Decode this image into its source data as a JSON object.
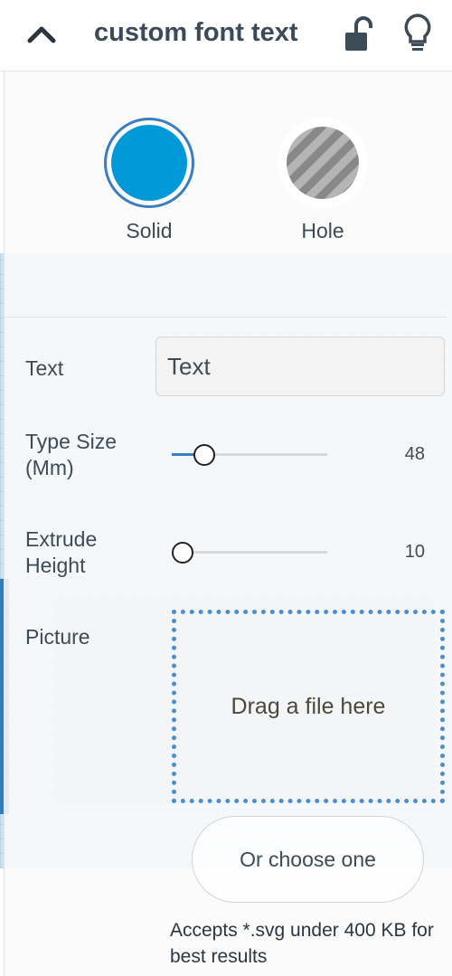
{
  "header": {
    "title": "custom font text"
  },
  "shape_types": [
    {
      "label": "Solid",
      "color": "#0099d8",
      "selected": true
    },
    {
      "label": "Hole",
      "color": "#9e9e9e",
      "selected": false
    }
  ],
  "properties": {
    "text": {
      "label": "Text",
      "value": "Text"
    },
    "type_size": {
      "label": "Type Size (Mm)",
      "value": "48"
    },
    "extrude_height": {
      "label": "Extrude Height",
      "value": "10"
    },
    "picture": {
      "label": "Picture"
    }
  },
  "dropzone": {
    "label": "Drag a file here"
  },
  "choose_button": {
    "label": "Or choose one"
  },
  "accepts_note": "Accepts *.svg under 400 KB for best results",
  "colors": {
    "accent": "#3a7ebf",
    "solid": "#0099d8"
  }
}
